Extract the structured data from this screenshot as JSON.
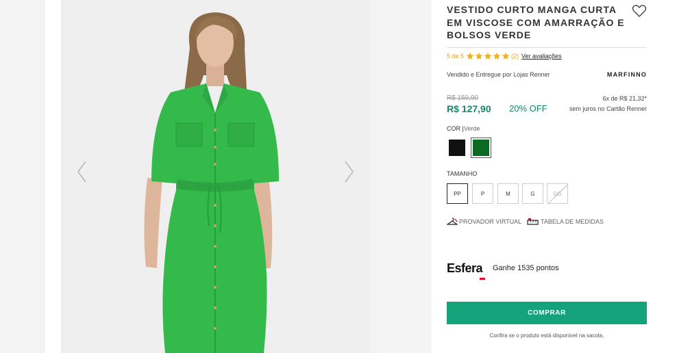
{
  "product": {
    "title": "VESTIDO CURTO MANGA CURTA EM VISCOSE COM AMARRAÇÃO E BOLSOS VERDE",
    "rating": {
      "score_text": "5 de 5",
      "stars": 5,
      "count_text": "(2)",
      "reviews_link": "Ver avaliações"
    },
    "seller": "Vendido e Entregue por Lojas Renner",
    "brand": "MARFINNO",
    "price": {
      "old": "R$ 159,90",
      "current": "R$ 127,90",
      "discount": "20% OFF",
      "installments": "6x de R$ 21,32*",
      "installments_note": "sem juros no Cartão Renner"
    },
    "color": {
      "label": "COR |",
      "selected": "Verde",
      "swatches": [
        {
          "name": "Preto",
          "hex": "#111111"
        },
        {
          "name": "Verde",
          "hex": "#0a6a22"
        }
      ]
    },
    "size": {
      "label": "TAMANHO",
      "options": [
        "PP",
        "P",
        "M",
        "G",
        "GG"
      ],
      "selected": "PP",
      "unavailable": [
        "GG"
      ]
    },
    "tools": {
      "virtual_fitting": "PROVADOR VIRTUAL",
      "size_chart": "TABELA DE MEDIDAS"
    },
    "esfera": {
      "logo": "Esfera",
      "points": "Ganhe 1535 pontos"
    },
    "buy_label": "COMPRAR",
    "availability_note": "Confira se o produto está disponível na sacola."
  },
  "colors": {
    "accent": "#14a37b",
    "price_green": "#10896a",
    "star_yellow": "#f2b01e",
    "dress_green": "#34b94b"
  }
}
